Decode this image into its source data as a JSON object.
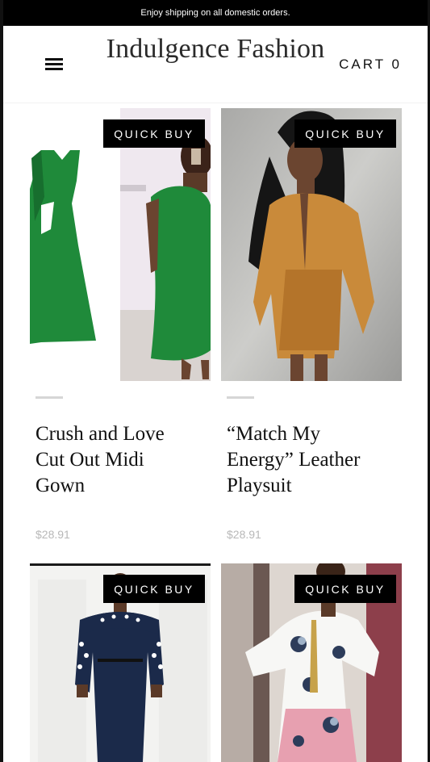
{
  "announcement": {
    "text": "Enjoy shipping on all domestic orders."
  },
  "header": {
    "brand": "Indulgence Fashion",
    "cart_label": "CART",
    "cart_count": "0"
  },
  "products": [
    {
      "title": "Crush and Love Cut Out Midi Gown",
      "price": "$28.91",
      "quick_buy": "QUICK BUY"
    },
    {
      "title": "“Match My Energy” Leather Playsuit",
      "price": "$28.91",
      "quick_buy": "QUICK BUY"
    },
    {
      "quick_buy": "QUICK BUY"
    },
    {
      "quick_buy": "QUICK BUY"
    }
  ],
  "colors": {
    "green": "#1f8a3a",
    "caramel": "#c98a3a",
    "navy": "#1b2a4a",
    "pink": "#e7a0b0"
  }
}
